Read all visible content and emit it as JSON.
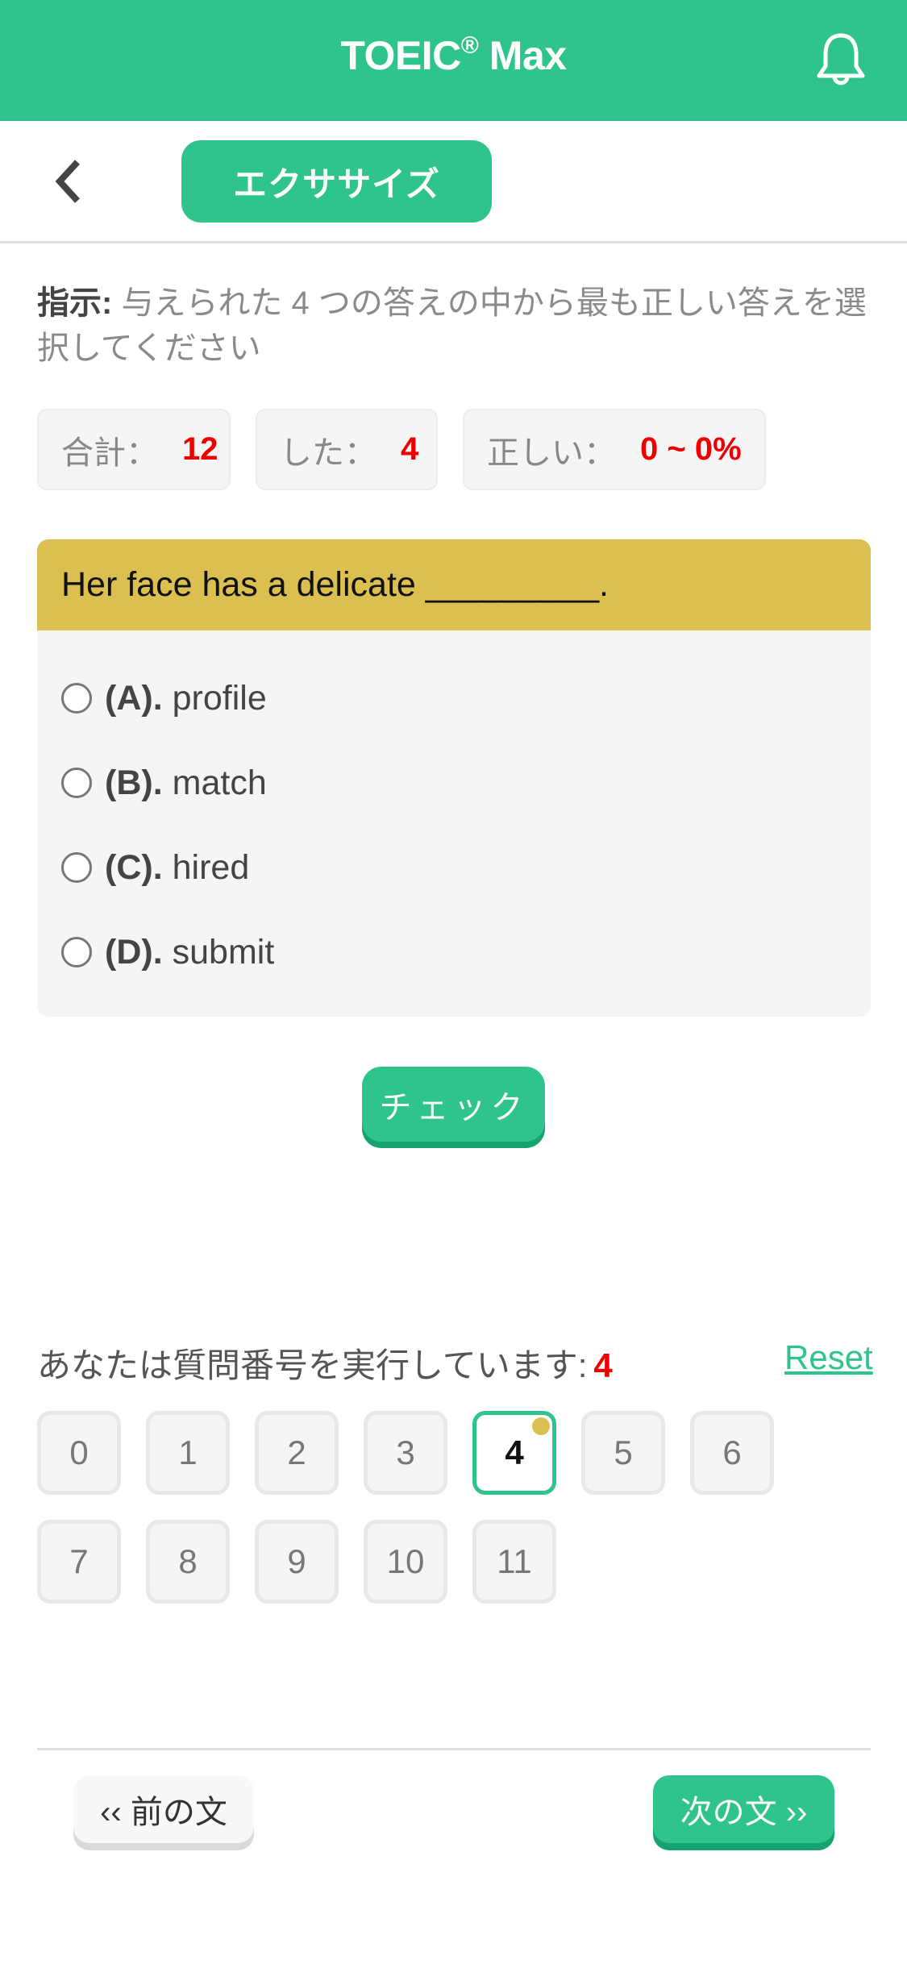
{
  "header": {
    "title": "TOEIC",
    "title_mark": "®",
    "title_suffix": " Max",
    "bell_icon": "bell-icon"
  },
  "subheader": {
    "back_icon": "chevron-left-icon",
    "tag_label": "エクササイズ"
  },
  "instruction": {
    "label": "指示:",
    "text": " 与えられた 4 つの答えの中から最も正しい答えを選択してください"
  },
  "stats": [
    {
      "label": "合計：",
      "value": "12"
    },
    {
      "label": "した：",
      "value": "4"
    },
    {
      "label": "正しい：",
      "value": "0 ~ 0%"
    }
  ],
  "question": {
    "text": "Her face has a delicate _________.",
    "options": [
      {
        "letter": "(A).",
        "text": "profile"
      },
      {
        "letter": "(B).",
        "text": "match"
      },
      {
        "letter": "(C).",
        "text": "hired"
      },
      {
        "letter": "(D).",
        "text": "submit"
      }
    ]
  },
  "check_label": "チェック",
  "progress": {
    "text": "あなたは質問番号を実行しています:",
    "current": "4",
    "reset_label": "Reset"
  },
  "question_numbers": [
    "0",
    "1",
    "2",
    "3",
    "4",
    "5",
    "6",
    "7",
    "8",
    "9",
    "10",
    "11"
  ],
  "active_question": 4,
  "nav": {
    "prev_label": "‹‹ 前の文",
    "next_label": "次の文 ››"
  },
  "colors": {
    "brand_green": "#2ec48b",
    "question_header": "#dbbf50",
    "highlight_red": "#ee0000"
  }
}
